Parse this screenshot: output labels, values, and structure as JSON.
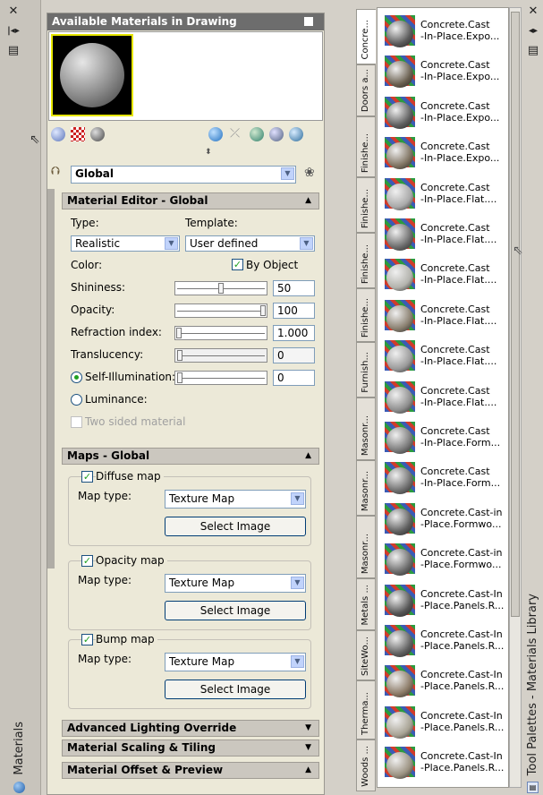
{
  "materials_palette": {
    "side_title": "Materials",
    "available_title": "Available Materials in Drawing",
    "selector_value": "Global",
    "editor": {
      "title": "Material Editor - Global",
      "type_label": "Type:",
      "type_value": "Realistic",
      "template_label": "Template:",
      "template_value": "User defined",
      "color_label": "Color:",
      "by_object_label": "By Object",
      "shininess_label": "Shininess:",
      "shininess_value": "50",
      "shininess_level": 0.5,
      "opacity_label": "Opacity:",
      "opacity_value": "100",
      "opacity_level": 1.0,
      "refraction_label": "Refraction index:",
      "refraction_value": "1.000",
      "refraction_level": 0.0,
      "translucency_label": "Translucency:",
      "translucency_value": "0",
      "self_illum_label": "Self-Illumination:",
      "self_illum_value": "0",
      "luminance_label": "Luminance:",
      "two_sided_label": "Two sided material"
    },
    "maps": {
      "title": "Maps - Global",
      "diffuse_label": "Diffuse map",
      "opacity_label": "Opacity map",
      "bump_label": "Bump map",
      "map_type_label": "Map type:",
      "map_type_value": "Texture Map",
      "select_image_label": "Select Image"
    },
    "advanced_lighting": "Advanced Lighting Override",
    "scaling_tiling": "Material Scaling & Tiling",
    "offset_preview": "Material Offset & Preview"
  },
  "tool_palette": {
    "side_title": "Tool Palettes - Materials Library",
    "tabs": [
      "Concre...",
      "Doors a...",
      "Finishe...",
      "Finishe...",
      "Finishe...",
      "Finishe...",
      "Furnish...",
      "Masonr...",
      "Masonr...",
      "Masonr...",
      "Metals ...",
      "SiteWo...",
      "Therma...",
      "Woods ..."
    ],
    "items": [
      {
        "l1": "Concrete.Cast",
        "l2": "-In-Place.Expo...",
        "tone": "#5a5a5a"
      },
      {
        "l1": "Concrete.Cast",
        "l2": "-In-Place.Expo...",
        "tone": "#6a6050"
      },
      {
        "l1": "Concrete.Cast",
        "l2": "-In-Place.Expo...",
        "tone": "#5e5e5e"
      },
      {
        "l1": "Concrete.Cast",
        "l2": "-In-Place.Expo...",
        "tone": "#807462"
      },
      {
        "l1": "Concrete.Cast",
        "l2": "-In-Place.Flat....",
        "tone": "#a9a9a9"
      },
      {
        "l1": "Concrete.Cast",
        "l2": "-In-Place.Flat....",
        "tone": "#6c6c6c"
      },
      {
        "l1": "Concrete.Cast",
        "l2": "-In-Place.Flat....",
        "tone": "#b3b3ad"
      },
      {
        "l1": "Concrete.Cast",
        "l2": "-In-Place.Flat....",
        "tone": "#8a8070"
      },
      {
        "l1": "Concrete.Cast",
        "l2": "-In-Place.Flat....",
        "tone": "#9a9a9a"
      },
      {
        "l1": "Concrete.Cast",
        "l2": "-In-Place.Flat....",
        "tone": "#8e8e8e"
      },
      {
        "l1": "Concrete.Cast",
        "l2": "-In-Place.Form...",
        "tone": "#7a7a7a"
      },
      {
        "l1": "Concrete.Cast",
        "l2": "-In-Place.Form...",
        "tone": "#6f6f6f"
      },
      {
        "l1": "Concrete.Cast-in",
        "l2": "-Place.Formwo...",
        "tone": "#5e5e5e"
      },
      {
        "l1": "Concrete.Cast-in",
        "l2": "-Place.Formwo...",
        "tone": "#6a6a6a"
      },
      {
        "l1": "Concrete.Cast-In",
        "l2": "-Place.Panels.R...",
        "tone": "#555555"
      },
      {
        "l1": "Concrete.Cast-In",
        "l2": "-Place.Panels.R...",
        "tone": "#606060"
      },
      {
        "l1": "Concrete.Cast-In",
        "l2": "-Place.Panels.R...",
        "tone": "#8b7a66"
      },
      {
        "l1": "Concrete.Cast-In",
        "l2": "-Place.Panels.R...",
        "tone": "#a8a394"
      },
      {
        "l1": "Concrete.Cast-In",
        "l2": "-Place.Panels.R...",
        "tone": "#9b9281"
      }
    ]
  }
}
